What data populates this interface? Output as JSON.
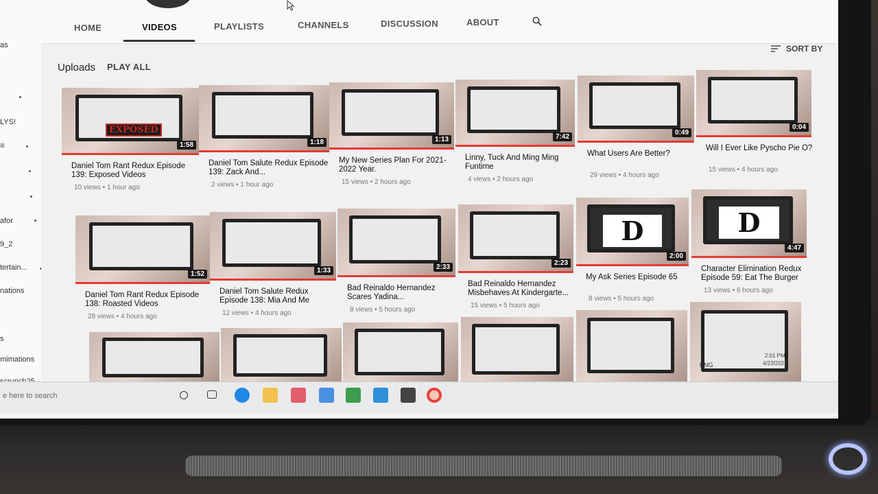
{
  "sidebar": {
    "items": [
      "as",
      "LYS!",
      "afor",
      "9_2",
      "tertain...",
      "nations",
      "s",
      "mimations",
      "scrunch25"
    ]
  },
  "tabs": {
    "home": "HOME",
    "videos": "VIDEOS",
    "playlists": "PLAYLISTS",
    "channels": "CHANNELS",
    "discussion": "DISCUSSION",
    "about": "ABOUT"
  },
  "section": {
    "uploads": "Uploads",
    "play_all": "PLAY ALL",
    "sort_by": "SORT BY"
  },
  "videos": [
    {
      "title": "Daniel Tom Rant Redux Episode 139: Exposed Videos",
      "meta": "10 views • 1 hour ago",
      "duration": "1:58",
      "thumb_color": "#5a4a48"
    },
    {
      "title": "Daniel Tom Salute Redux Episode 139: Zack And...",
      "meta": "2 views • 1 hour ago",
      "duration": "1:18",
      "thumb_color": "#4d4643"
    },
    {
      "title": "My New Series Plan For 2021-2022 Year.",
      "meta": "15 views • 2 hours ago",
      "duration": "1:13",
      "thumb_color": "#6b5e58"
    },
    {
      "title": "Linny, Tuck And Ming Ming Funtime",
      "meta": "4 views • 2 hours ago",
      "duration": "7:42",
      "thumb_color": "#6a5d57"
    },
    {
      "title": "What Users Are Better?",
      "meta": "29 views • 4 hours ago",
      "duration": "0:49",
      "thumb_color": "#58504c"
    },
    {
      "title": "Will I Ever Like Pyscho Pie O?",
      "meta": "15 views • 4 hours ago",
      "duration": "0:04",
      "thumb_color": "#7d6e66"
    },
    {
      "title": "Daniel Tom Rant Redux Episode 138: Roasted Videos",
      "meta": "28 views • 4 hours ago",
      "duration": "1:52",
      "thumb_color": "#5b4f4b"
    },
    {
      "title": "Daniel Tom Salute Redux Episode 138: Mia And Me",
      "meta": "12 views • 4 hours ago",
      "duration": "1:33",
      "thumb_color": "#625651"
    },
    {
      "title": "Bad Reinaldo Hernandez Scares Yadina...",
      "meta": "8 views • 5 hours ago",
      "duration": "2:33",
      "thumb_color": "#4a4340"
    },
    {
      "title": "Bad Reinaldo Hernandez Misbehaves At Kindergarte...",
      "meta": "15 views • 5 hours ago",
      "duration": "2:23",
      "thumb_color": "#4e4642"
    },
    {
      "title": "My Ask Series Episode 65",
      "meta": "8 views • 5 hours ago",
      "duration": "2:00",
      "thumb_color": "#3e3835"
    },
    {
      "title": "Character Elimination Redux Episode 59: Eat The Burger",
      "meta": "13 views • 6 hours ago",
      "duration": "4:47",
      "thumb_color": "#3e3835"
    }
  ],
  "big_letter": "D",
  "exposed_stamp": "EXPOSED",
  "taskbar": {
    "search_placeholder": "e here to search",
    "lang": "ENG",
    "time": "2:01 PM",
    "date": "4/23/2021"
  }
}
